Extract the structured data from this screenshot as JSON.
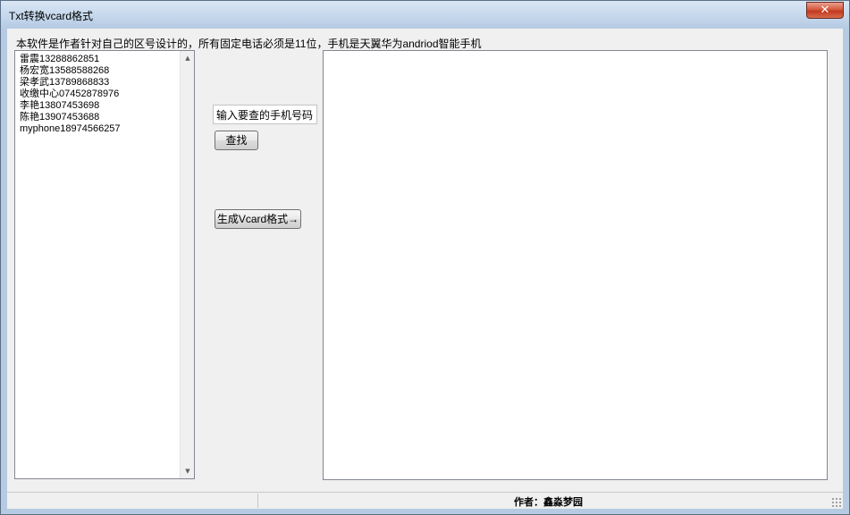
{
  "window": {
    "title": "Txt转换vcard格式",
    "close_symbol": "✕"
  },
  "main": {
    "description": "本软件是作者针对自己的区号设计的，所有固定电话必须是11位，手机是天翼华为andriod智能手机",
    "contacts": [
      "雷震13288862851",
      "杨宏宽13588588268",
      "梁孝武13789868833",
      "收缴中心07452878976",
      "李艳13807453698",
      "陈艳13907453688",
      "myphone18974566257"
    ],
    "search_value": "输入要查的手机号码",
    "find_label": "查找",
    "generate_label": "生成Vcard格式→",
    "output_text": ""
  },
  "statusbar": {
    "author": "作者：鑫淼梦园"
  },
  "icons": {
    "scroll_up": "scroll-up-arrow-icon",
    "scroll_down": "scroll-down-arrow-icon",
    "close": "close-icon",
    "resize_grip": "resize-grip-icon"
  },
  "colors": {
    "close_button": "#d45a3f",
    "window_frame": "#c3d6eb"
  }
}
